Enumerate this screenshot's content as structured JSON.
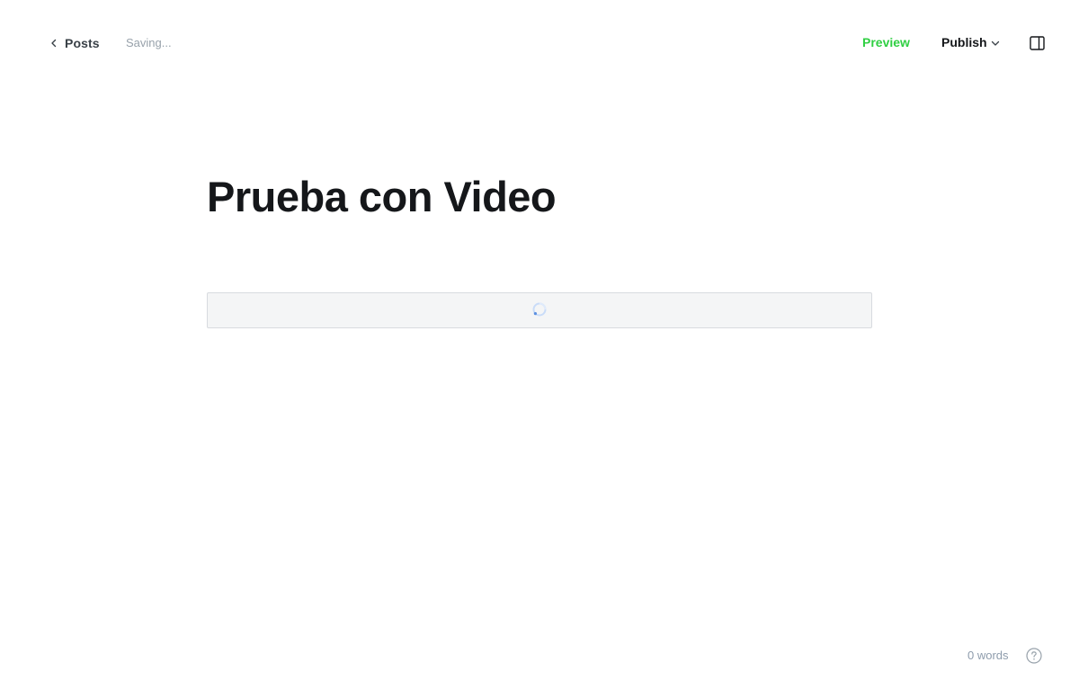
{
  "header": {
    "back_label": "Posts",
    "status": "Saving...",
    "preview_label": "Preview",
    "publish_label": "Publish",
    "icons": {
      "back": "chevron-left-icon",
      "publish_menu": "chevron-down-icon",
      "sidebar": "sidebar-toggle-icon"
    },
    "colors": {
      "preview": "#30cf43"
    }
  },
  "editor": {
    "title": "Prueba con Video",
    "video_card": {
      "state": "loading",
      "icon": "spinner-icon"
    }
  },
  "footer": {
    "word_count": "0 words",
    "help_icon": "help-icon"
  }
}
